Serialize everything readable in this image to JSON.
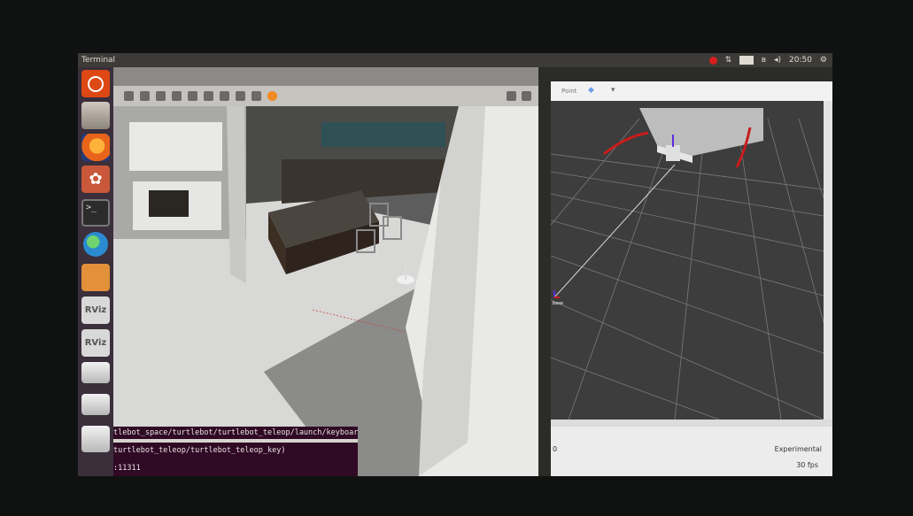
{
  "topbar": {
    "title": "Terminal",
    "clock": "20:50",
    "keyboard_indicator": "En",
    "icons": [
      "record-icon",
      "network-icon",
      "keyboard-icon",
      "bluetooth-icon",
      "volume-icon",
      "gear-icon"
    ]
  },
  "launcher": {
    "items": [
      {
        "name": "ubuntu-dash",
        "icon": "ubuntu-logo-icon"
      },
      {
        "name": "files",
        "icon": "file-cabinet-icon"
      },
      {
        "name": "firefox",
        "icon": "firefox-icon"
      },
      {
        "name": "system-settings",
        "icon": "settings-icon"
      },
      {
        "name": "terminal",
        "icon": "terminal-icon",
        "label": ">_"
      },
      {
        "name": "browser",
        "icon": "globe-icon"
      },
      {
        "name": "software-center",
        "icon": "box-icon"
      },
      {
        "name": "rviz-1",
        "icon": "rviz-icon",
        "label": "RViz"
      },
      {
        "name": "rviz-2",
        "icon": "rviz-icon",
        "label": "RViz"
      },
      {
        "name": "workspace-1",
        "icon": "workspace-icon"
      },
      {
        "name": "workspace-2",
        "icon": "workspace-icon"
      },
      {
        "name": "trash",
        "icon": "trash-icon"
      }
    ]
  },
  "gazebo": {
    "toolbar_icons": [
      "arrow-icon",
      "translate-icon",
      "rotate-icon",
      "scale-icon",
      "box-icon",
      "sphere-icon",
      "cylinder-icon",
      "point-light-icon",
      "spot-light-icon",
      "directional-light-icon"
    ],
    "toolbar_right_icons": [
      "camera-icon",
      "record-icon"
    ]
  },
  "terminal": {
    "line1": "tlebot_space/turtlebot/turtlebot_teleop/launch/keyboard",
    "line2": "turtlebot_teleop/turtlebot_teleop_key)",
    "line3": ":11311"
  },
  "rviz": {
    "tool_label": "Point",
    "axis_label": "base",
    "status_label": "Experimental",
    "fps": "30 fps",
    "left_label": "0"
  }
}
